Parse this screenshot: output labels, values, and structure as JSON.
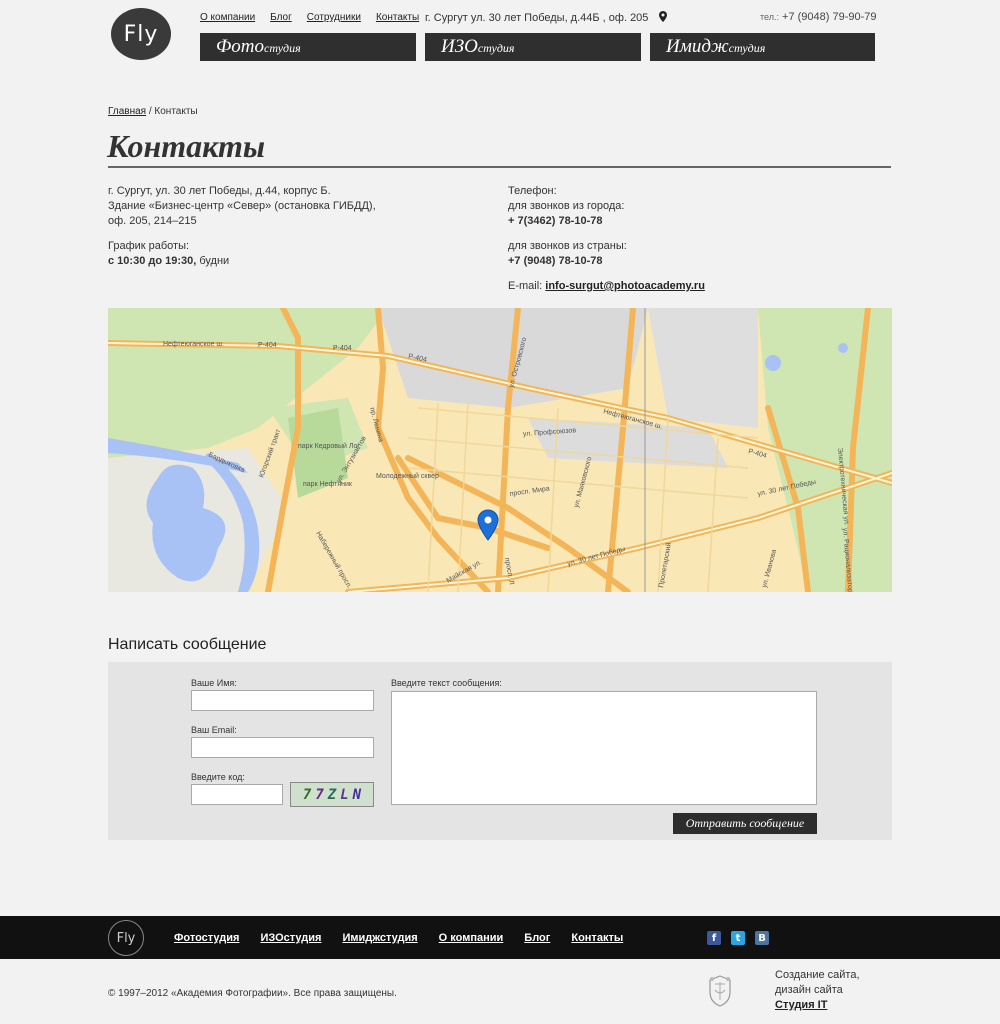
{
  "header": {
    "logo": "Fly",
    "nav": [
      "О компании",
      "Блог",
      "Сотрудники",
      "Контакты"
    ],
    "address": "г. Сургут ул. 30 лет Победы, д.44Б , оф. 205",
    "phone_label": "тел.:",
    "phone": "+7 (9048) 79-90-79",
    "studios": [
      {
        "big": "Фото",
        "small": "студия"
      },
      {
        "big": "ИЗО",
        "small": "студия"
      },
      {
        "big": "Имидж",
        "small": "студия"
      }
    ]
  },
  "breadcrumb": {
    "home": "Главная",
    "sep": " / ",
    "current": "Контакты"
  },
  "page_title": "Контакты",
  "contacts": {
    "address_lines": [
      "г. Сургут, ул. 30 лет Победы, д.44, корпус Б.",
      "Здание «Бизнес-центр «Север» (остановка ГИБДД),",
      "оф. 205, 214–215"
    ],
    "schedule_label": "График работы:",
    "schedule_time": "с 10:30 до 19:30,",
    "schedule_days": " будни",
    "phone_label": "Телефон:",
    "city_label": "для звонков из города:",
    "city_phone": "+ 7(3462) 78-10-78",
    "country_label": "для звонков из страны:",
    "country_phone": "+7 (9048) 78-10-78",
    "email_label": "E-mail: ",
    "email": "info-surgut@photoacademy.ru"
  },
  "map": {
    "labels": [
      "Нефтеюганское ш.",
      "Р-404",
      "Р-404",
      "Р-404",
      "ул. Островского",
      "Нефтеюганское ш.",
      "Р-404",
      "ул. Профсоюзов",
      "Югорский тракт",
      "парк Кедровый Лог",
      "парк Нефтяник",
      "Бардыковка",
      "пр. Ленина",
      "ул. Энтузиастов",
      "Молодежный сквер",
      "просп. Мира",
      "ул. Маяковского",
      "ул. 30 лет Победы",
      "ул. 30 лет Победы",
      "Набережный просп.",
      "Майская ул.",
      "Электротехническая ул.",
      "ул. Рационализаторов",
      "ул. Иванова",
      "Пролетарский",
      "просп. Л"
    ]
  },
  "form": {
    "title": "Написать сообщение",
    "name_label": "Ваше Имя:",
    "email_label": "Ваш Email:",
    "code_label": "Введите код:",
    "message_label": "Введите текст сообщения:",
    "captcha": [
      "7",
      "7",
      "Z",
      "L",
      "N"
    ],
    "submit": "Отправить сообщение"
  },
  "footer": {
    "logo": "Fly",
    "nav": [
      "Фотостудия",
      "ИЗОстудия",
      "Имиджстудия",
      "О компании",
      "Блог",
      "Контакты"
    ],
    "social": [
      "f",
      "t",
      "B"
    ],
    "copyright": "© 1997–2012 «Академия Фотографии». Все права защищены.",
    "dev_line1": "Создание сайта,",
    "dev_line2": "дизайн сайта",
    "dev_link": "Студия IT"
  },
  "colors": {
    "facebook": "#3b5998",
    "twitter": "#2aa6e0",
    "vk": "#4c75a3",
    "map_base": "#f9e7b6",
    "map_green": "#cfe6b3",
    "map_water": "#a8c2f5",
    "map_road": "#f3b557"
  }
}
